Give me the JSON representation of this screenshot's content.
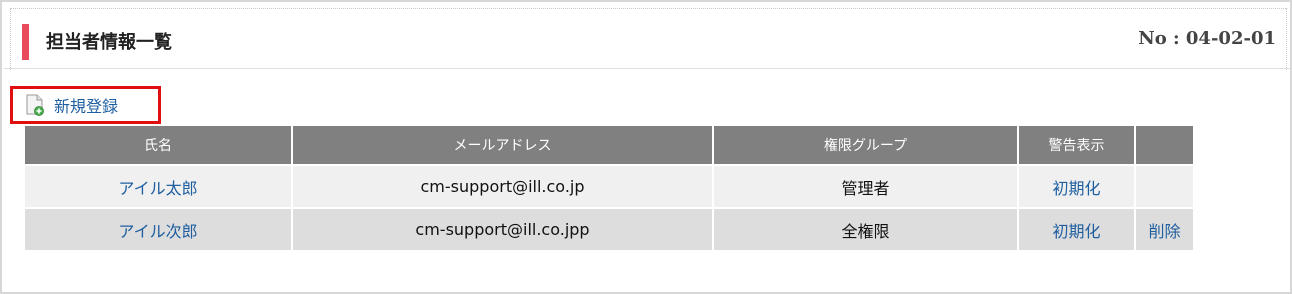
{
  "header": {
    "title": "担当者情報一覧",
    "page_no": "No : 04-02-01",
    "accent_color": "#e84c5c"
  },
  "actions": {
    "new_register_label": "新規登録",
    "new_register_icon": "document-add-icon"
  },
  "table": {
    "columns": [
      "氏名",
      "メールアドレス",
      "権限グループ",
      "警告表示",
      ""
    ],
    "rows": [
      {
        "name": "アイル太郎",
        "email": "cm-support@ill.co.jp",
        "group": "管理者",
        "warning": "初期化",
        "delete": ""
      },
      {
        "name": "アイル次郎",
        "email": "cm-support@ill.co.jpp",
        "group": "全権限",
        "warning": "初期化",
        "delete": "削除"
      }
    ],
    "header_color": "#808080",
    "link_color": "#1f5fa0"
  },
  "highlight": {
    "color": "#e01010"
  }
}
